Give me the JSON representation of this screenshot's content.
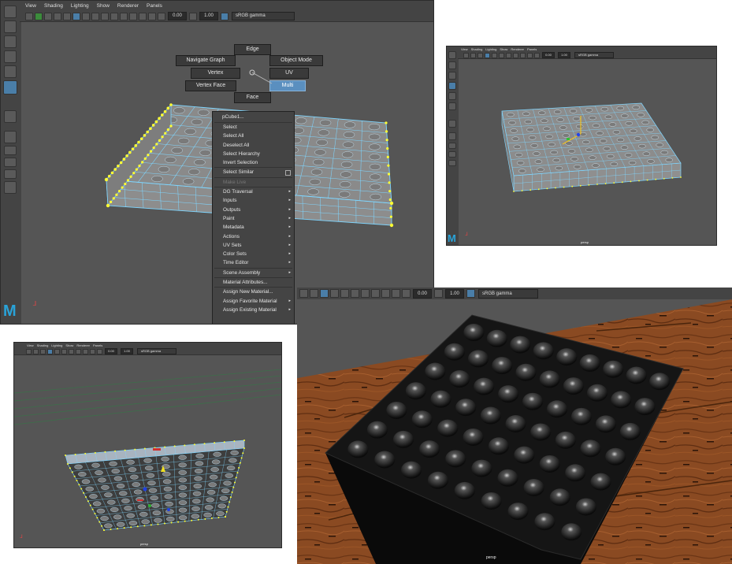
{
  "panel_main": {
    "menu": [
      "View",
      "Shading",
      "Lighting",
      "Show",
      "Renderer",
      "Panels"
    ],
    "field_a": "0.00",
    "field_b": "1.00",
    "color_space": "sRGB gamma",
    "marking_menu": {
      "edge": "Edge",
      "navigate_graph": "Navigate Graph",
      "object_mode": "Object Mode",
      "vertex": "Vertex",
      "uv": "UV",
      "vertex_face": "Vertex Face",
      "multi": "Multi",
      "face": "Face"
    },
    "context_menu": {
      "header": "pCube1...",
      "items": [
        {
          "label": "Select",
          "arrow": ""
        },
        {
          "label": "Select All",
          "arrow": ""
        },
        {
          "label": "Deselect All",
          "arrow": ""
        },
        {
          "label": "Select Hierarchy",
          "arrow": ""
        },
        {
          "label": "Invert Selection",
          "arrow": ""
        },
        {
          "label": "Select Similar",
          "arrow": ""
        },
        {
          "label": "Make Live",
          "arrow": ""
        },
        {
          "label": "DG Traversal",
          "arrow": "▸"
        },
        {
          "label": "Inputs",
          "arrow": "▸"
        },
        {
          "label": "Outputs",
          "arrow": "▸"
        },
        {
          "label": "Paint",
          "arrow": "▸"
        },
        {
          "label": "Metadata",
          "arrow": "▸"
        },
        {
          "label": "Actions",
          "arrow": "▸"
        },
        {
          "label": "UV Sets",
          "arrow": "▸"
        },
        {
          "label": "Color Sets",
          "arrow": "▸"
        },
        {
          "label": "Time Editor",
          "arrow": "▸"
        },
        {
          "label": "Scene Assembly",
          "arrow": "▸"
        },
        {
          "label": "Material Attributes...",
          "arrow": ""
        },
        {
          "label": "Assign New Material...",
          "arrow": ""
        },
        {
          "label": "Assign Favorite Material",
          "arrow": "▸"
        },
        {
          "label": "Assign Existing Material",
          "arrow": "▸"
        }
      ]
    },
    "logo": "M"
  },
  "panel_top_right": {
    "menu": [
      "View",
      "Shading",
      "Lighting",
      "Show",
      "Renderer",
      "Panels"
    ],
    "field_a": "0.00",
    "field_b": "1.00",
    "color_space": "sRGB gamma",
    "camera": "persp",
    "logo": "M"
  },
  "panel_bottom_left": {
    "menu": [
      "View",
      "Shading",
      "Lighting",
      "Show",
      "Renderer",
      "Panels"
    ],
    "field_a": "0.00",
    "field_b": "1.00",
    "color_space": "sRGB gamma",
    "camera": "persp"
  },
  "panel_bottom_right": {
    "field_a": "0.00",
    "field_b": "1.00",
    "color_space": "sRGB gamma",
    "camera": "persp"
  },
  "colors": {
    "ui_bg": "#444444",
    "viewport_bg": "#555555",
    "wire": "#7fd6ff",
    "vertex_select": "#ffff33",
    "highlight": "#5a8fbf",
    "wood": "#8a4a22"
  },
  "icons": [
    "select-arrow-icon",
    "lasso-icon",
    "paint-select-icon",
    "move-icon",
    "rotate-icon",
    "scale-icon",
    "maya-logo-icon",
    "axis-gizmo-icon"
  ]
}
